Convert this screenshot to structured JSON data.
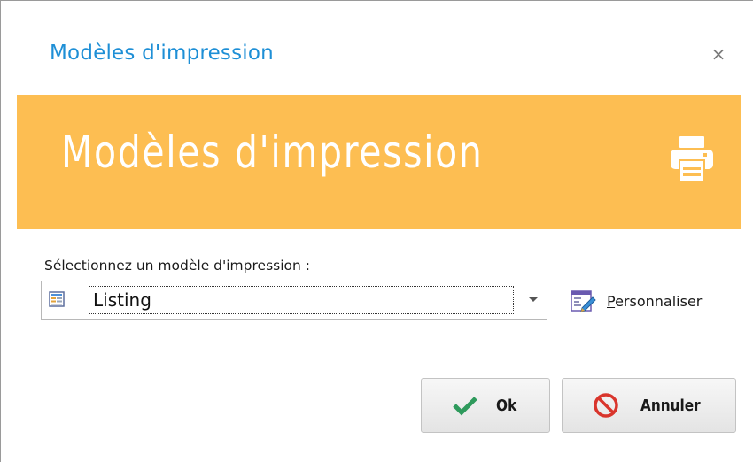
{
  "window": {
    "title": "Modèles d'impression",
    "close_glyph": "×"
  },
  "banner": {
    "title": "Modèles d'impression",
    "icon": "printer-icon",
    "color": "#fdbe52"
  },
  "form": {
    "label": "Sélectionnez un modèle d'impression :",
    "selected_template": "Listing",
    "selected_icon": "document-listing-icon"
  },
  "customize": {
    "label_first": "P",
    "label_rest": "ersonnaliser",
    "icon": "edit-form-icon"
  },
  "buttons": {
    "ok": {
      "label_first": "O",
      "label_rest": "k",
      "icon": "checkmark-icon",
      "icon_color": "#2e9a5c"
    },
    "cancel": {
      "label_first": "A",
      "label_rest": "nnuler",
      "icon": "cancel-icon",
      "icon_color": "#d9352c"
    }
  },
  "colors": {
    "title": "#1e8fd6"
  }
}
